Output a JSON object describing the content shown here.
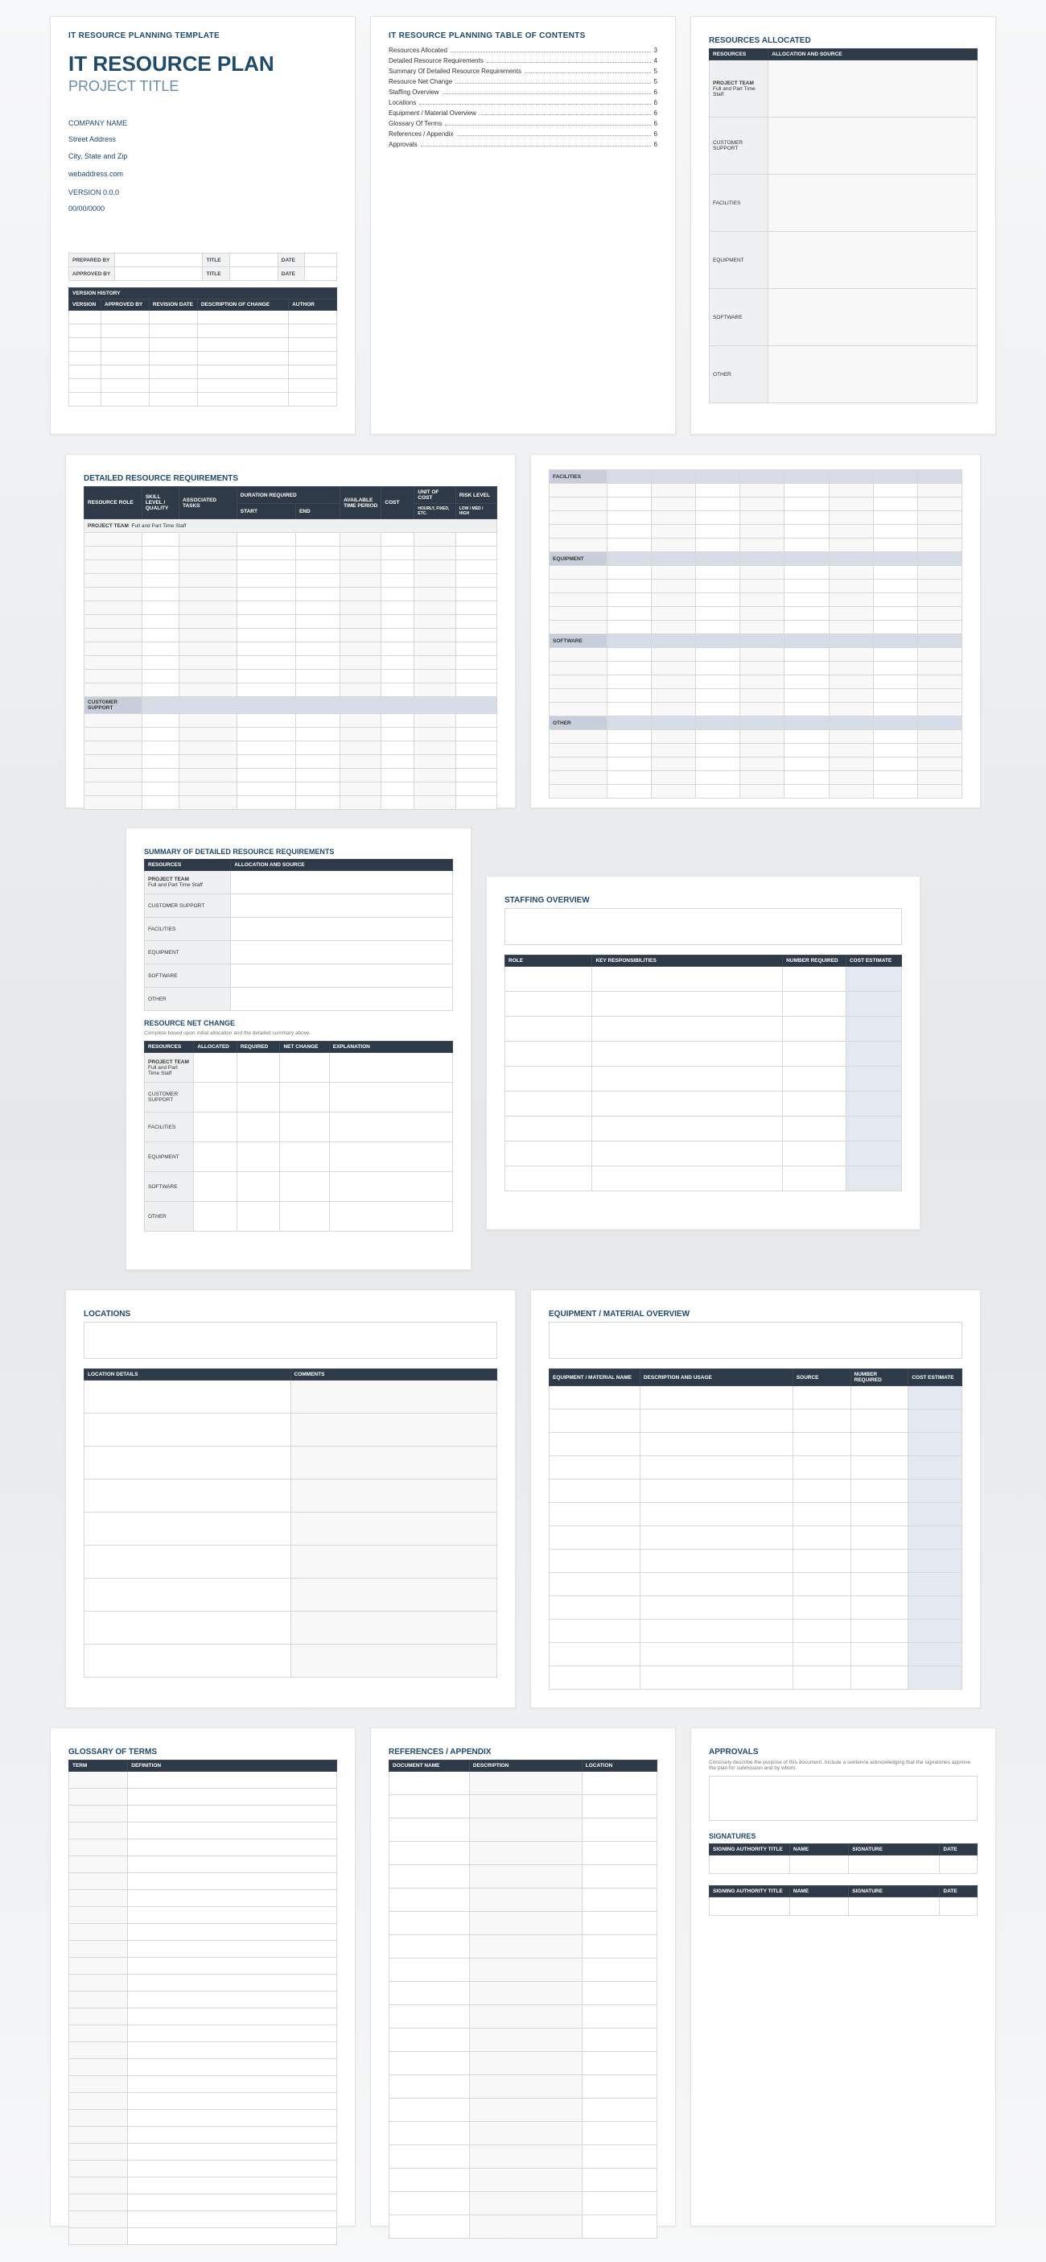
{
  "p1": {
    "hdr": "IT RESOURCE PLANNING TEMPLATE",
    "title": "IT RESOURCE PLAN",
    "subtitle": "PROJECT TITLE",
    "company": "COMPANY NAME",
    "street": "Street Address",
    "city": "City, State and Zip",
    "web": "webaddress.com",
    "version": "VERSION 0.0.0",
    "date": "00/00/0000",
    "prep_by": "PREPARED BY",
    "title_l": "TITLE",
    "date_l": "DATE",
    "appr_by": "APPROVED BY",
    "vh": "VERSION HISTORY",
    "vh_cols": [
      "VERSION",
      "APPROVED BY",
      "REVISION DATE",
      "DESCRIPTION OF CHANGE",
      "AUTHOR"
    ]
  },
  "p2": {
    "hdr": "IT RESOURCE PLANNING TABLE OF CONTENTS",
    "items": [
      [
        "Resources Allocated",
        "3"
      ],
      [
        "Detailed Resource Requirements",
        "4"
      ],
      [
        "Summary Of Detailed Resource Requirements",
        "5"
      ],
      [
        "Resource Net Change",
        "5"
      ],
      [
        "Staffing Overview",
        "6"
      ],
      [
        "Locations",
        "6"
      ],
      [
        "Equipment / Material Overview",
        "6"
      ],
      [
        "Glossary Of Terms",
        "6"
      ],
      [
        "References / Appendix",
        "6"
      ],
      [
        "Approvals",
        "6"
      ]
    ]
  },
  "p3": {
    "title": "RESOURCES ALLOCATED",
    "cols": [
      "RESOURCES",
      "ALLOCATION AND SOURCE"
    ],
    "rows": [
      [
        "PROJECT TEAM",
        "Full and Part Time Staff"
      ],
      [
        "CUSTOMER SUPPORT",
        ""
      ],
      [
        "FACILITIES",
        ""
      ],
      [
        "EQUIPMENT",
        ""
      ],
      [
        "SOFTWARE",
        ""
      ],
      [
        "OTHER",
        ""
      ]
    ]
  },
  "p4": {
    "title": "DETAILED RESOURCE REQUIREMENTS",
    "cols": [
      "RESOURCE ROLE",
      "SKILL LEVEL / QUALITY",
      "ASSOCIATED TASKS",
      "DURATION REQUIRED",
      "",
      "AVAILABLE TIME PERIOD",
      "COST",
      "UNIT OF COST",
      "RISK LEVEL"
    ],
    "sub": [
      "",
      "",
      "",
      "START",
      "END",
      "",
      "",
      "Hourly, fixed, etc.",
      "Low / Med / High"
    ],
    "rowhdr": [
      "PROJECT TEAM",
      "Full and Part Time Staff"
    ],
    "band": "CUSTOMER SUPPORT"
  },
  "p5": {
    "bands": [
      "FACILITIES",
      "EQUIPMENT",
      "SOFTWARE",
      "OTHER"
    ]
  },
  "p6": {
    "title1": "SUMMARY OF DETAILED RESOURCE REQUIREMENTS",
    "cols1": [
      "RESOURCES",
      "ALLOCATION AND SOURCE"
    ],
    "rows1": [
      [
        "PROJECT TEAM",
        "Full and Part Time Staff"
      ],
      [
        "CUSTOMER SUPPORT",
        ""
      ],
      [
        "FACILITIES",
        ""
      ],
      [
        "EQUIPMENT",
        ""
      ],
      [
        "SOFTWARE",
        ""
      ],
      [
        "OTHER",
        ""
      ]
    ],
    "title2": "RESOURCE NET CHANGE",
    "desc2": "Complete based upon initial allocation and the detailed summary above.",
    "cols2": [
      "RESOURCES",
      "ALLOCATED",
      "REQUIRED",
      "NET CHANGE",
      "EXPLANATION"
    ],
    "rows2": [
      "PROJECT TEAM",
      "CUSTOMER SUPPORT",
      "FACILITIES",
      "EQUIPMENT",
      "SOFTWARE",
      "OTHER"
    ],
    "sub2": "Full and Part Time Staff"
  },
  "p7": {
    "title": "STAFFING OVERVIEW",
    "cols": [
      "ROLE",
      "KEY RESPONSIBILITIES",
      "NUMBER REQUIRED",
      "COST ESTIMATE"
    ]
  },
  "p8": {
    "title": "LOCATIONS",
    "cols": [
      "LOCATION DETAILS",
      "COMMENTS"
    ]
  },
  "p9": {
    "title": "EQUIPMENT / MATERIAL OVERVIEW",
    "cols": [
      "EQUIPMENT / MATERIAL NAME",
      "DESCRIPTION AND USAGE",
      "SOURCE",
      "NUMBER REQUIRED",
      "COST ESTIMATE"
    ]
  },
  "p10": {
    "title": "GLOSSARY OF TERMS",
    "cols": [
      "TERM",
      "DEFINITION"
    ]
  },
  "p11": {
    "title": "REFERENCES / APPENDIX",
    "cols": [
      "DOCUMENT NAME",
      "DESCRIPTION",
      "LOCATION"
    ]
  },
  "p12": {
    "title": "APPROVALS",
    "desc": "Concisely describe the purpose of this document. Include a sentence acknowledging that the signatories approve the plan for submission and by whom.",
    "sig": "SIGNATURES",
    "cols": [
      "SIGNING AUTHORITY TITLE",
      "NAME",
      "SIGNATURE",
      "DATE"
    ]
  }
}
